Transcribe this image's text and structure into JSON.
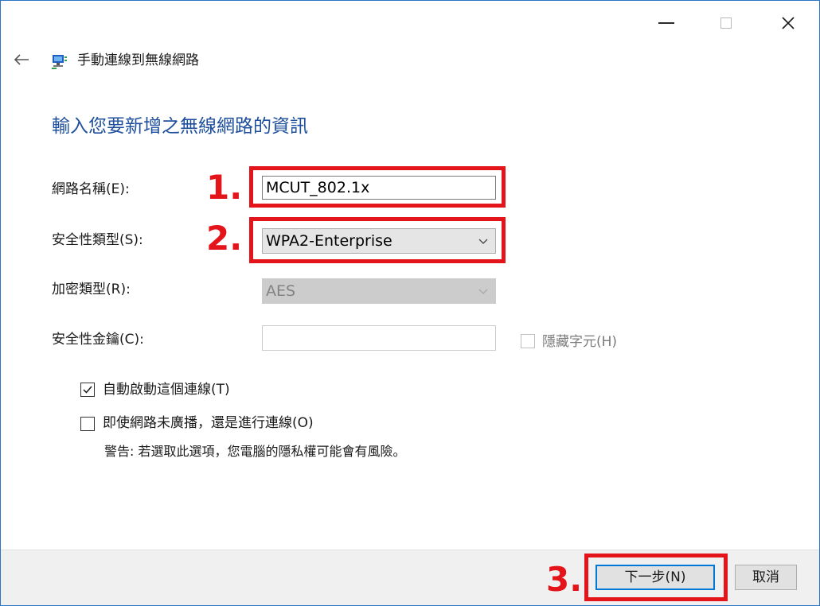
{
  "window": {
    "header_title": "手動連線到無線網路",
    "main_heading": "輸入您要新增之無線網路的資訊"
  },
  "form": {
    "network_name_label": "網路名稱(E):",
    "network_name_value": "MCUT_802.1x",
    "security_type_label": "安全性類型(S):",
    "security_type_value": "WPA2-Enterprise",
    "encryption_type_label": "加密類型(R):",
    "encryption_type_value": "AES",
    "security_key_label": "安全性金鑰(C):",
    "security_key_value": "",
    "hide_chars_label": "隱藏字元(H)",
    "hide_chars_checked": false,
    "auto_start_label": "自動啟動這個連線(T)",
    "auto_start_checked": true,
    "connect_hidden_label": "即使網路未廣播，還是進行連線(O)",
    "connect_hidden_checked": false,
    "warning_text": "警告: 若選取此選項，您電腦的隱私權可能會有風險。"
  },
  "annotations": {
    "step1": "1.",
    "step2": "2.",
    "step3": "3."
  },
  "buttons": {
    "next_label": "下一步(N)",
    "cancel_label": "取消"
  },
  "icons": {
    "back": "back-arrow-icon",
    "network": "network-icon",
    "minimize": "minimize-icon",
    "maximize": "maximize-icon",
    "close": "close-icon"
  },
  "colors": {
    "heading_blue": "#1e4f9c",
    "annotation_red": "#e4141b",
    "primary_button_border": "#0078d7",
    "window_border": "#2b74c6"
  }
}
